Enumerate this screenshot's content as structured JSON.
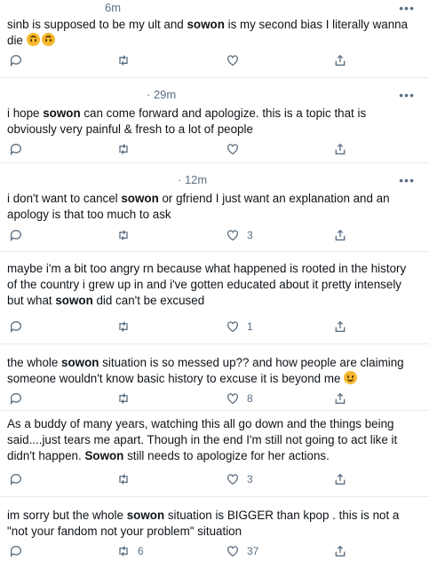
{
  "tweets": [
    {
      "time": "6m",
      "parts": [
        "sinb is supposed to be my ult and ",
        "sowon",
        " is my second bias I literally wanna die "
      ],
      "emoji": "upside-down-face",
      "emoji_count": 2,
      "likes": "",
      "retweets": ""
    },
    {
      "time": "· 29m",
      "parts": [
        "i hope ",
        "sowon",
        " can come forward and apologize. this is a topic that is obviously very painful & fresh to a lot of people"
      ],
      "likes": "",
      "retweets": ""
    },
    {
      "time": "· 12m",
      "parts": [
        "i don't want to cancel ",
        "sowon",
        " or gfriend I just want an explanation and an apology is that too much to ask"
      ],
      "likes": "3",
      "retweets": ""
    },
    {
      "time": "",
      "parts": [
        "maybe i'm a bit too angry rn because what happened is rooted in the history of the country i grew up in and i've gotten educated about it pretty intensely but what ",
        "sowon",
        " did can't be excused"
      ],
      "likes": "1",
      "retweets": ""
    },
    {
      "time": "",
      "parts": [
        "the whole ",
        "sowon",
        " situation is so messed up?? and how people are claiming someone wouldn't know basic history to excuse it is beyond me "
      ],
      "emoji": "grinning-face",
      "emoji_count": 1,
      "likes": "8",
      "retweets": ""
    },
    {
      "time": "",
      "parts": [
        "As a buddy of many years, watching this all go down and the things being said....just tears me apart. Though in the end I'm still not going to act like it didn't happen. ",
        "Sowon",
        " still needs to apologize for her actions."
      ],
      "likes": "3",
      "retweets": ""
    },
    {
      "time": "",
      "parts": [
        "im sorry but the whole ",
        "sowon",
        " situation is BIGGER than kpop . this is not a \"not your fandom not your problem\" situation"
      ],
      "likes": "37",
      "retweets": "6"
    }
  ]
}
